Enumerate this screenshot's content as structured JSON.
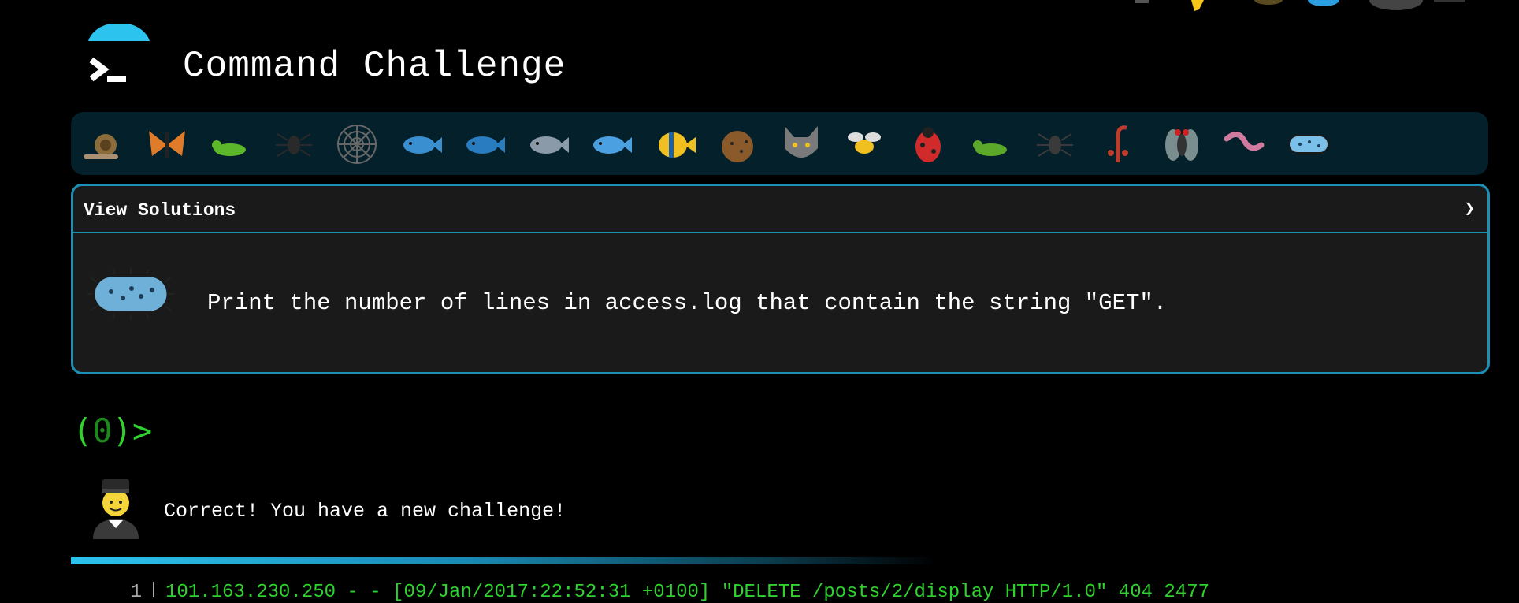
{
  "app": {
    "title": "Command Challenge"
  },
  "animals": [
    {
      "name": "snail-icon",
      "color": "#8a6d3b"
    },
    {
      "name": "butterfly-icon",
      "color": "#e07b2a"
    },
    {
      "name": "caterpillar-icon",
      "color": "#5cb82a"
    },
    {
      "name": "ant-icon",
      "color": "#2a2a2a"
    },
    {
      "name": "spider-web-icon",
      "color": "#666666"
    },
    {
      "name": "whale-icon",
      "color": "#3a8fd0"
    },
    {
      "name": "whale2-icon",
      "color": "#2a7cc0"
    },
    {
      "name": "dolphin-icon",
      "color": "#8a9aa8"
    },
    {
      "name": "fish-icon",
      "color": "#4aa0e0"
    },
    {
      "name": "tropical-fish-icon",
      "color": "#f0c020"
    },
    {
      "name": "blowfish-icon",
      "color": "#8a5a2a"
    },
    {
      "name": "wolf-icon",
      "color": "#7a7a7a"
    },
    {
      "name": "bee-icon",
      "color": "#e0d060"
    },
    {
      "name": "ladybug-icon",
      "color": "#d02a2a"
    },
    {
      "name": "cricket-icon",
      "color": "#5ca82a"
    },
    {
      "name": "spider-icon",
      "color": "#3a3a3a"
    },
    {
      "name": "scorpion-icon",
      "color": "#c03a2a"
    },
    {
      "name": "fly-icon",
      "color": "#8a8a8a"
    },
    {
      "name": "worm-icon",
      "color": "#d07aa0"
    },
    {
      "name": "microbe-icon",
      "color": "#7ac0e8"
    }
  ],
  "solutions": {
    "title": "View Solutions",
    "chevron": "❯",
    "challenge": "Print the number of lines in access.log that contain the string \"GET\"."
  },
  "prompt": {
    "open": "(",
    "count": "0",
    "close": ")>"
  },
  "message": {
    "text": "Correct! You have a new challenge!"
  },
  "log": {
    "line_number": "1",
    "line": "101.163.230.250 - - [09/Jan/2017:22:52:31 +0100] \"DELETE /posts/2/display HTTP/1.0\" 404 2477"
  },
  "colors": {
    "accent": "#1d8fb5",
    "prompt_green": "#2fd12f",
    "panel_bg": "#1a1a1a",
    "bar_bg": "#04202b"
  }
}
